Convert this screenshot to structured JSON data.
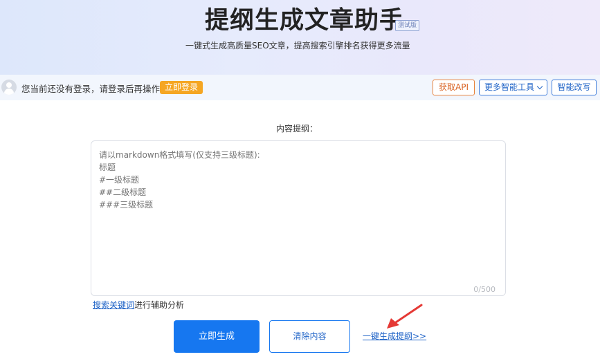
{
  "header": {
    "title": "提纲生成文章助手",
    "badge": "测试版",
    "subtitle": "一键式生成高质量SEO文章，提高搜索引擎排名获得更多流量"
  },
  "login_bar": {
    "message": "您当前还没有登录，请登录后再操作",
    "login_button": "立即登录",
    "api_button": "获取API",
    "more_tools_button": "更多智能工具",
    "rewrite_button": "智能改写"
  },
  "form": {
    "label": "内容提纲：",
    "placeholder": "请以markdown格式填写(仅支持三级标题):\n标题\n#一级标题\n##二级标题\n###三级标题",
    "counter": "0/500",
    "helper_link": "搜索关键词",
    "helper_text": "进行辅助分析"
  },
  "actions": {
    "generate": "立即生成",
    "clear": "清除内容",
    "one_click_outline": "一键生成提纲>>"
  },
  "colors": {
    "primary": "#1677f0",
    "accent_orange": "#f5a623",
    "annotation_arrow": "#e53935"
  },
  "icons": {
    "avatar": "user-avatar-icon",
    "dropdown": "chevron-down-icon",
    "annotation": "red-arrow-icon"
  }
}
